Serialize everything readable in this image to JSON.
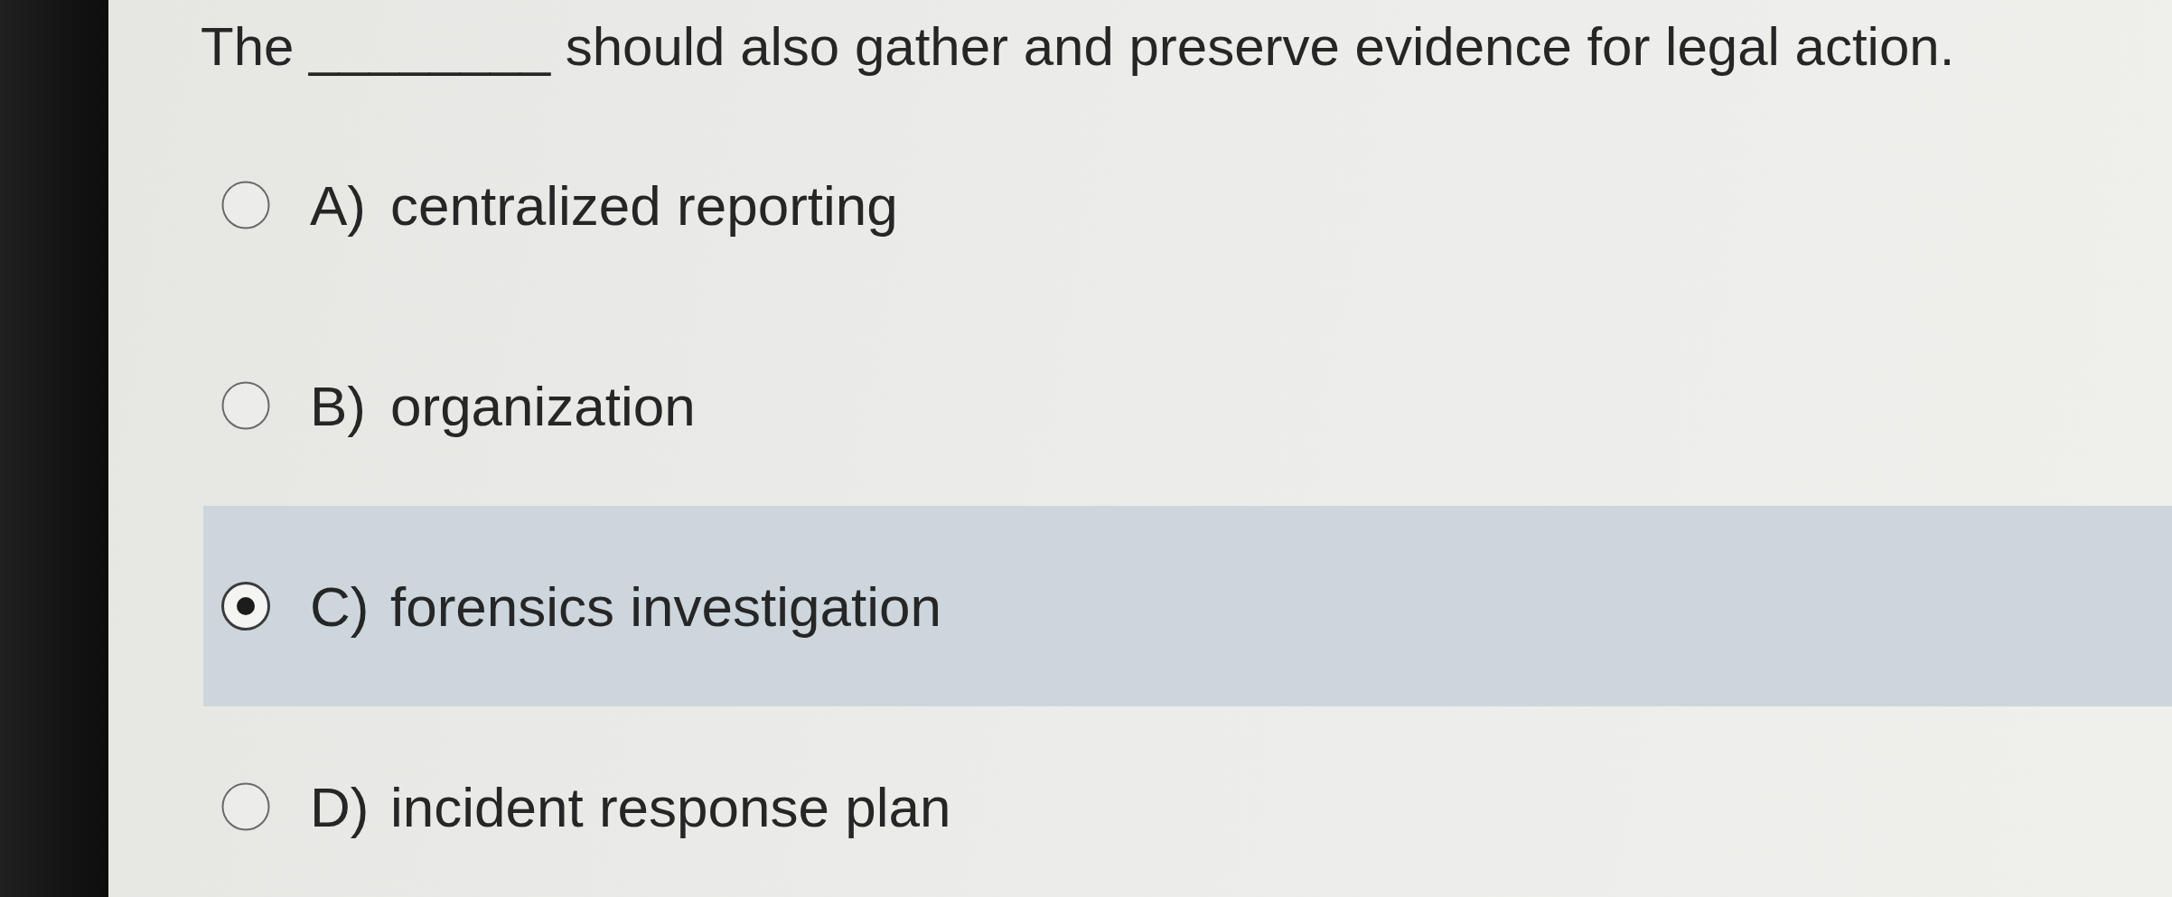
{
  "question": "The ________ should also gather and preserve evidence for legal action.",
  "options": [
    {
      "letter": "A)",
      "text": "centralized reporting",
      "selected": false
    },
    {
      "letter": "B)",
      "text": "organization",
      "selected": false
    },
    {
      "letter": "C)",
      "text": "forensics investigation",
      "selected": true
    },
    {
      "letter": "D)",
      "text": "incident response plan",
      "selected": false
    }
  ]
}
